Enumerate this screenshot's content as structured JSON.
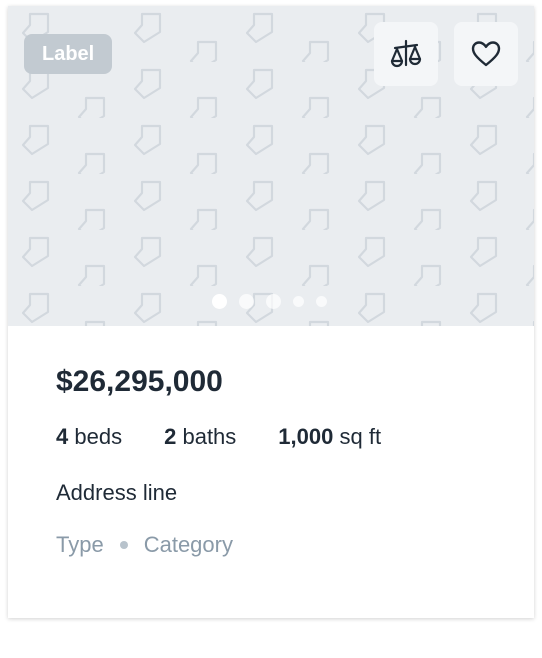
{
  "listing": {
    "label": "Label",
    "price": "$26,295,000",
    "beds_value": "4",
    "beds_unit": "beds",
    "baths_value": "2",
    "baths_unit": "baths",
    "area_value": "1,000",
    "area_unit": "sq ft",
    "address": "Address line",
    "type": "Type",
    "category": "Category"
  },
  "media": {
    "placeholder_icon": "tag-icon",
    "slide_count": 5,
    "active_slide": 1
  },
  "actions": {
    "compare_icon": "scale-icon",
    "favorite_icon": "heart-icon"
  },
  "colors": {
    "text": "#1f2a36",
    "muted": "#8a9aa8",
    "media_bg": "#eaedf0",
    "badge_bg": "#c2cad1"
  }
}
